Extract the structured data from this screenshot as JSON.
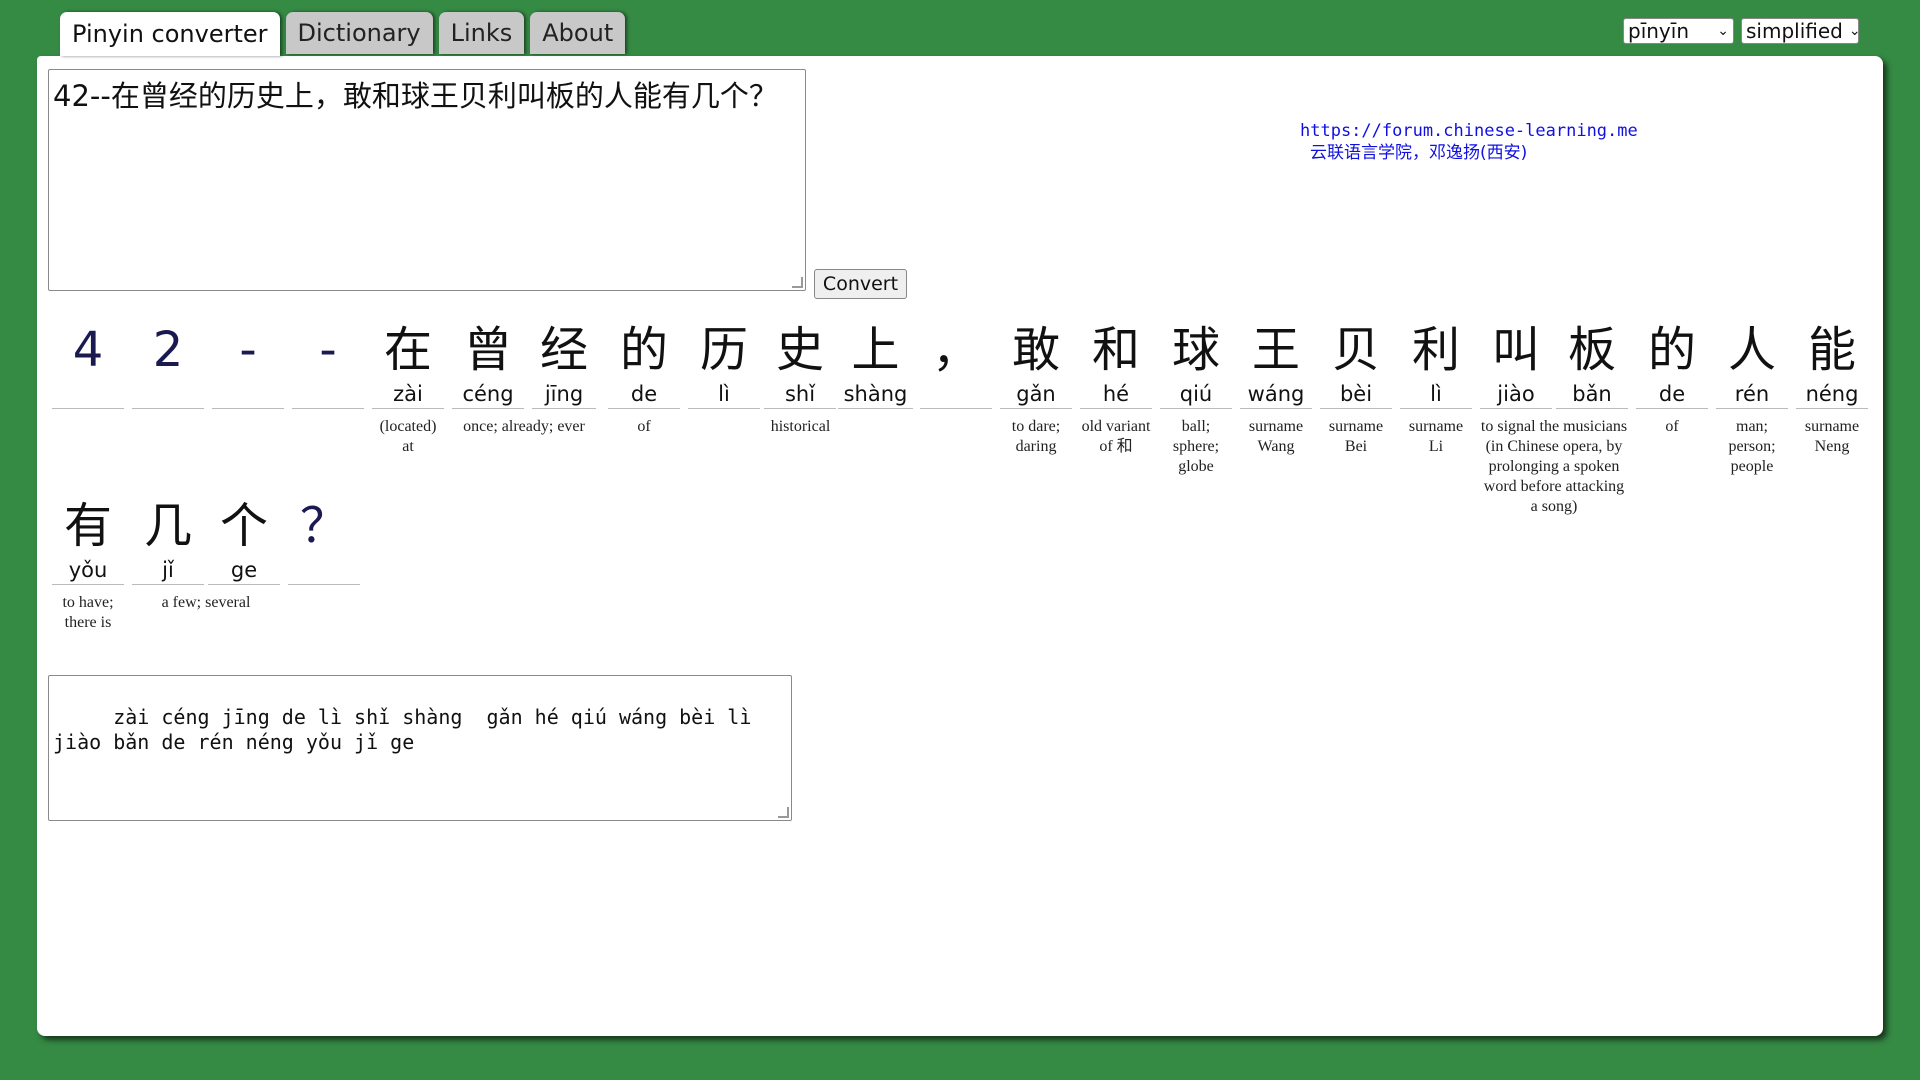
{
  "tabs": [
    "Pinyin converter",
    "Dictionary",
    "Links",
    "About"
  ],
  "selects": {
    "mode": "pīnyīn",
    "script": "simplified"
  },
  "input_text": "42--在曾经的历史上，敢和球王贝利叫板的人能有几个？",
  "convert_label": "Convert",
  "credit": {
    "url": "https://forum.chinese-learning.me",
    "org": "云联语言学院，邓逸扬(西安)"
  },
  "row1": [
    {
      "h": "4",
      "p": ""
    },
    {
      "h": "2",
      "p": ""
    },
    {
      "h": "-",
      "p": ""
    },
    {
      "h": "-",
      "p": ""
    },
    {
      "h": "在",
      "p": "zài"
    },
    {
      "h": "曾",
      "p": "céng"
    },
    {
      "h": "经",
      "p": "jīng"
    },
    {
      "h": "的",
      "p": "de"
    },
    {
      "h": "历",
      "p": "lì"
    },
    {
      "h": "史",
      "p": "shǐ"
    },
    {
      "h": "上",
      "p": "shàng"
    },
    {
      "h": "，",
      "p": ""
    },
    {
      "h": "敢",
      "p": "gǎn"
    },
    {
      "h": "和",
      "p": "hé"
    },
    {
      "h": "球",
      "p": "qiú"
    },
    {
      "h": "王",
      "p": "wáng"
    },
    {
      "h": "贝",
      "p": "bèi"
    },
    {
      "h": "利",
      "p": "lì"
    },
    {
      "h": "叫",
      "p": "jiào"
    },
    {
      "h": "板",
      "p": "bǎn"
    },
    {
      "h": "的",
      "p": "de"
    },
    {
      "h": "人",
      "p": "rén"
    },
    {
      "h": "能",
      "p": "néng"
    }
  ],
  "row2": [
    {
      "h": "有",
      "p": "yǒu"
    },
    {
      "h": "几",
      "p": "jǐ"
    },
    {
      "h": "个",
      "p": "ge"
    },
    {
      "h": "？",
      "p": ""
    }
  ],
  "defs1": [
    "(located) at",
    "once; already; ever",
    "of",
    "historical",
    "to dare; daring",
    "old variant of 和",
    "ball; sphere; globe",
    "surname Wang",
    "surname Bei",
    "surname Li",
    "to signal the musicians (in Chinese opera, by prolonging a spoken word before attacking a song)",
    "of",
    "man; person; people",
    "surname Neng"
  ],
  "defs2": [
    "to have; there is",
    "a few; several"
  ],
  "output_text": "   zài céng jīng de lì shǐ shàng  gǎn hé qiú wáng bèi lì jiào bǎn de rén néng yǒu jǐ ge"
}
